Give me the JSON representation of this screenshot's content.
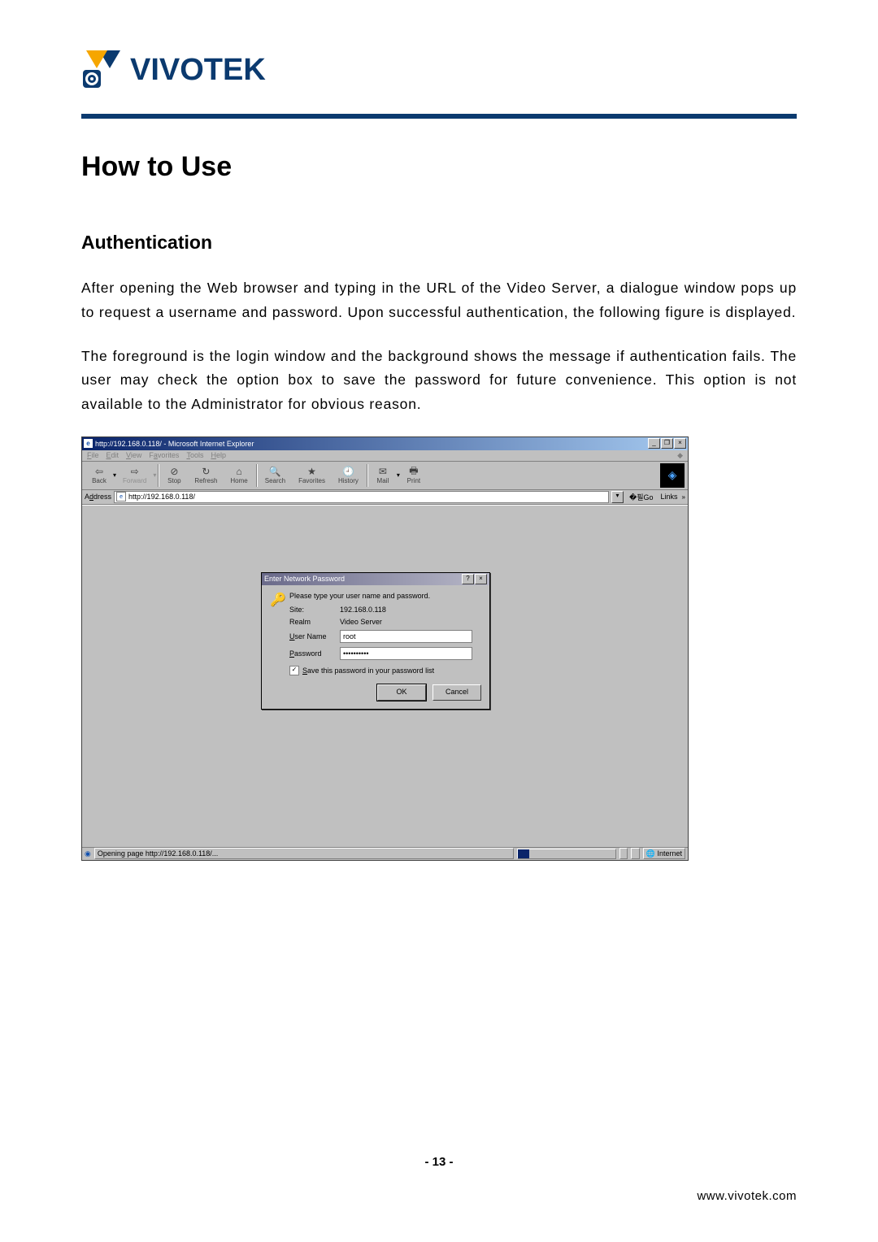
{
  "logo_text": "VIVOTEK",
  "heading": "How to Use",
  "subheading": "Authentication",
  "para1": "After opening the Web browser and typing in the URL of the Video Server, a dialogue window pops up to request a username and password. Upon successful authentication, the following figure is displayed.",
  "para2": "The foreground is the login window and the background shows the message if authentication fails. The user may check the option box to save the password for future convenience.  This option is not available to the Administrator for obvious reason.",
  "ie": {
    "title": "http://192.168.0.118/ - Microsoft Internet Explorer",
    "menus": [
      "File",
      "Edit",
      "View",
      "Favorites",
      "Tools",
      "Help"
    ],
    "toolbar": {
      "back": "Back",
      "forward": "Forward",
      "stop": "Stop",
      "refresh": "Refresh",
      "home": "Home",
      "search": "Search",
      "favorites": "Favorites",
      "history": "History",
      "mail": "Mail",
      "print": "Print"
    },
    "address_label": "Address",
    "address_value": "http://192.168.0.118/",
    "go_label": "Go",
    "links_label": "Links",
    "status_text": "Opening page http://192.168.0.118/...",
    "zone": "Internet"
  },
  "dialog": {
    "title": "Enter Network Password",
    "prompt": "Please type your user name and password.",
    "site_label": "Site:",
    "site_value": "192.168.0.118",
    "realm_label": "Realm",
    "realm_value": "Video Server",
    "user_label": "User Name",
    "user_value": "root",
    "pass_label": "Password",
    "pass_value": "••••••••••",
    "save_label": "Save this password in your password list",
    "ok": "OK",
    "cancel": "Cancel"
  },
  "page_number": "- 13 -",
  "footer_url": "www.vivotek.com"
}
